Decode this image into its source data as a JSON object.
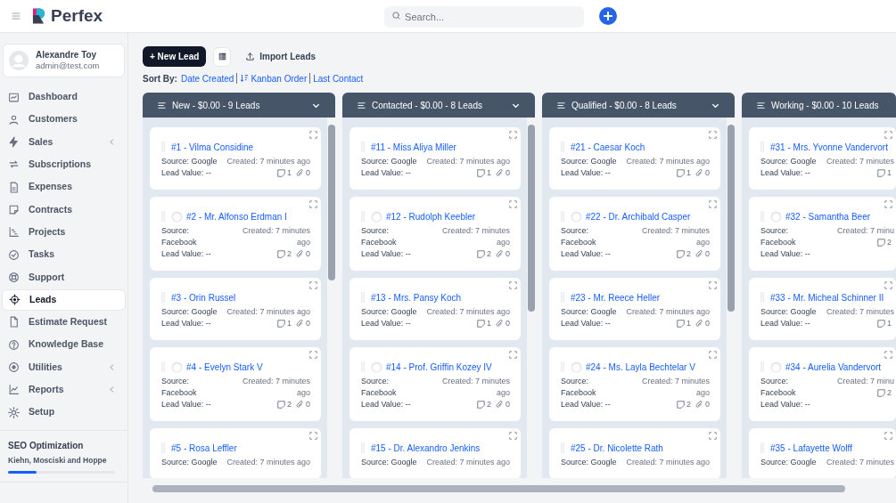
{
  "header": {
    "brand": "Perfex",
    "search": {
      "placeholder": "Search..."
    }
  },
  "sidebar": {
    "user": {
      "name": "Alexandre Toy",
      "email": "admin@test.com"
    },
    "items": [
      {
        "label": "Dashboard",
        "selected": false,
        "has_submenu": false
      },
      {
        "label": "Customers",
        "selected": false,
        "has_submenu": false
      },
      {
        "label": "Sales",
        "selected": false,
        "has_submenu": true
      },
      {
        "label": "Subscriptions",
        "selected": false,
        "has_submenu": false
      },
      {
        "label": "Expenses",
        "selected": false,
        "has_submenu": false
      },
      {
        "label": "Contracts",
        "selected": false,
        "has_submenu": false
      },
      {
        "label": "Projects",
        "selected": false,
        "has_submenu": false
      },
      {
        "label": "Tasks",
        "selected": false,
        "has_submenu": false
      },
      {
        "label": "Support",
        "selected": false,
        "has_submenu": false
      },
      {
        "label": "Leads",
        "selected": true,
        "has_submenu": false
      },
      {
        "label": "Estimate Request",
        "selected": false,
        "has_submenu": false
      },
      {
        "label": "Knowledge Base",
        "selected": false,
        "has_submenu": false
      },
      {
        "label": "Utilities",
        "selected": false,
        "has_submenu": true
      },
      {
        "label": "Reports",
        "selected": false,
        "has_submenu": true
      },
      {
        "label": "Setup",
        "selected": false,
        "has_submenu": false
      }
    ],
    "project": {
      "name": "SEO Optimization",
      "client": "Kiehn, Mosciski and Hoppe",
      "level": 0.27
    }
  },
  "toolbar": {
    "new_button": "+ New Lead",
    "import_button": "Import Leads"
  },
  "sort": {
    "label": "Sort By:",
    "options": [
      "Date Created",
      "Kanban Order",
      "Last Contact"
    ]
  },
  "columns": [
    {
      "title": "New - $0.00 - 9 Leads",
      "expand_toggle": true,
      "cards": [
        {
          "kind": "plain",
          "title": "#1 - Vilma Considine",
          "source": "Source: Google",
          "created": "Created: 7 minutes ago",
          "lead_value": "Lead Value: --",
          "comments": "1",
          "attachments": "0"
        },
        {
          "kind": "avatar",
          "title": "#2 - Mr. Alfonso Erdman I",
          "source": "Source: Facebook",
          "created": "Created: 7 minutes ago",
          "lead_value": "Lead Value: --",
          "comments": "2",
          "attachments": "0"
        },
        {
          "kind": "plain",
          "title": "#3 - Orin Russel",
          "source": "Source: Google",
          "created": "Created: 7 minutes ago",
          "lead_value": "Lead Value: --",
          "comments": "1",
          "attachments": "0"
        },
        {
          "kind": "avatar",
          "title": "#4 - Evelyn Stark V",
          "source": "Source: Facebook",
          "created": "Created: 7 minutes ago",
          "lead_value": "Lead Value: --",
          "comments": "2",
          "attachments": "0"
        },
        {
          "kind": "plain",
          "title": "#5 - Rosa Leffler",
          "source": "Source: Google",
          "created": "Created: 7 minutes ago"
        }
      ]
    },
    {
      "title": "Contacted - $0.00 - 8 Leads",
      "expand_toggle": true,
      "cards": [
        {
          "kind": "plain",
          "title": "#11 - Miss Aliya Miller",
          "source": "Source: Google",
          "created": "Created: 7 minutes ago",
          "lead_value": "Lead Value: --",
          "comments": "1",
          "attachments": "0"
        },
        {
          "kind": "avatar",
          "title": "#12 - Rudolph Keebler",
          "source": "Source: Facebook",
          "created": "Created: 7 minutes ago",
          "lead_value": "Lead Value: --",
          "comments": "2",
          "attachments": "0"
        },
        {
          "kind": "plain",
          "title": "#13 - Mrs. Pansy Koch",
          "source": "Source: Google",
          "created": "Created: 7 minutes ago",
          "lead_value": "Lead Value: --",
          "comments": "1",
          "attachments": "0"
        },
        {
          "kind": "avatar",
          "title": "#14 - Prof. Griffin Kozey IV",
          "source": "Source: Facebook",
          "created": "Created: 7 minutes ago",
          "lead_value": "Lead Value: --",
          "comments": "2",
          "attachments": "0"
        },
        {
          "kind": "plain",
          "title": "#15 - Dr. Alexandro Jenkins",
          "source": "Source: Google",
          "created": "Created: 7 minutes ago"
        }
      ]
    },
    {
      "title": "Qualified - $0.00 - 8 Leads",
      "expand_toggle": true,
      "cards": [
        {
          "kind": "plain",
          "title": "#21 - Caesar Koch",
          "source": "Source: Google",
          "created": "Created: 7 minutes ago",
          "lead_value": "Lead Value: --",
          "comments": "1",
          "attachments": "0"
        },
        {
          "kind": "avatar",
          "title": "#22 - Dr. Archibald Casper",
          "source": "Source: Facebook",
          "created": "Created: 7 minutes ago",
          "lead_value": "Lead Value: --",
          "comments": "2",
          "attachments": "0"
        },
        {
          "kind": "plain",
          "title": "#23 - Mr. Reece Heller",
          "source": "Source: Google",
          "created": "Created: 7 minutes ago",
          "lead_value": "Lead Value: --",
          "comments": "1",
          "attachments": "0"
        },
        {
          "kind": "avatar",
          "title": "#24 - Ms. Layla Bechtelar V",
          "source": "Source: Facebook",
          "created": "Created: 7 minutes ago",
          "lead_value": "Lead Value: --",
          "comments": "2",
          "attachments": "0"
        },
        {
          "kind": "plain",
          "title": "#25 - Dr. Nicolette Rath",
          "source": "Source: Google",
          "created": "Created: 7 minutes ago"
        }
      ]
    },
    {
      "title": "Working - $0.00 - 10 Leads",
      "expand_toggle": false,
      "cards": [
        {
          "kind": "plain",
          "title": "#31 - Mrs. Yvonne Vandervort",
          "source": "Source: Google",
          "created": "Created: 7 minutes",
          "lead_value": "Lead Value: --",
          "comments": "1"
        },
        {
          "kind": "avatar",
          "title": "#32 - Samantha Beer",
          "source": "Source: Facebook",
          "created": "Created: 7 minu",
          "lead_value": "Lead Value: --",
          "comments": "2"
        },
        {
          "kind": "plain",
          "title": "#33 - Mr. Micheal Schinner II",
          "source": "Source: Google",
          "created": "Created: 7 minutes",
          "lead_value": "Lead Value: --",
          "comments": "1"
        },
        {
          "kind": "avatar",
          "title": "#34 - Aurelia Vandervort",
          "source": "Source: Facebook",
          "created": "Created: 7 minu",
          "lead_value": "Lead Value: --",
          "comments": "2"
        },
        {
          "kind": "plain",
          "title": "#35 - Lafayette Wolff",
          "source": "Source: Google",
          "created": "Created: 7 minutes"
        }
      ]
    }
  ]
}
